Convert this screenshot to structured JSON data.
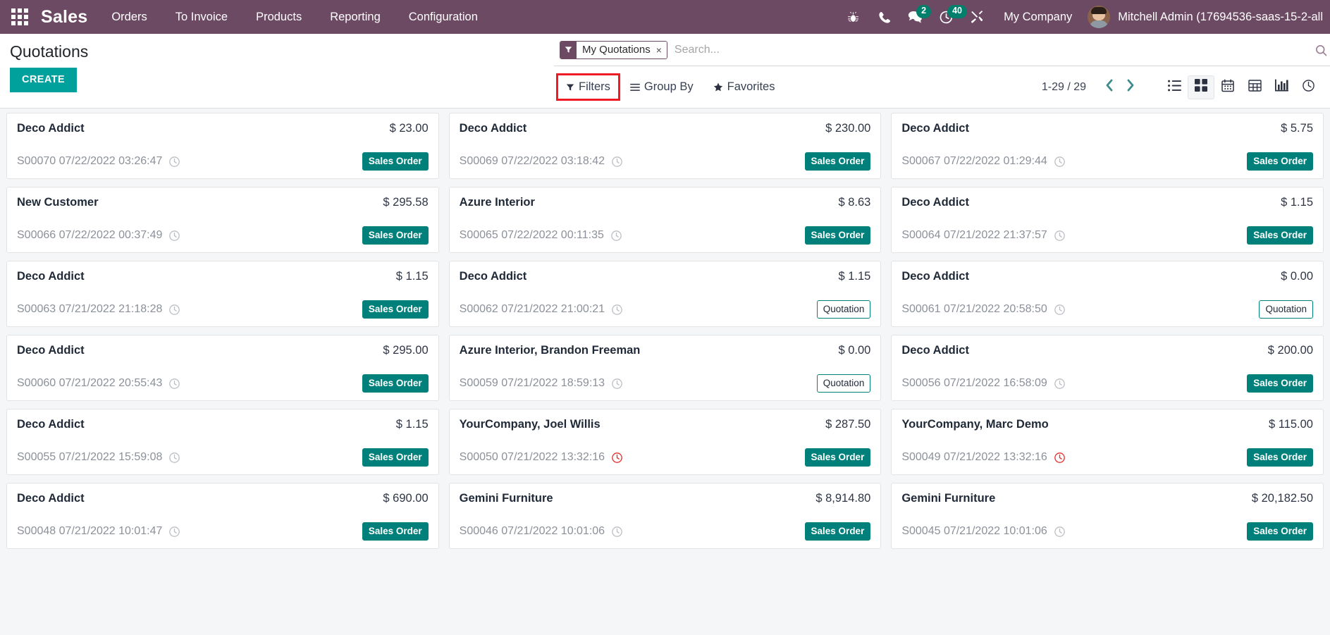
{
  "navbar": {
    "apps_icon": "apps-grid-icon",
    "brand": "Sales",
    "menus": [
      {
        "label": "Orders"
      },
      {
        "label": "To Invoice"
      },
      {
        "label": "Products"
      },
      {
        "label": "Reporting"
      },
      {
        "label": "Configuration"
      }
    ],
    "systray": [
      {
        "icon": "bug-icon",
        "badge": ""
      },
      {
        "icon": "phone-icon",
        "badge": ""
      },
      {
        "icon": "messages-icon",
        "badge": "2"
      },
      {
        "icon": "activities-clock-icon",
        "badge": "40"
      },
      {
        "icon": "tools-icon",
        "badge": ""
      }
    ],
    "company": "My Company",
    "user": "Mitchell Admin (17694536-saas-15-2-all"
  },
  "control_panel": {
    "title": "Quotations",
    "create_label": "CREATE",
    "search": {
      "facet_label": "My Quotations",
      "facet_icon": "filter-funnel-icon",
      "facet_close": "×",
      "placeholder": "Search...",
      "value": "",
      "magnifier_icon": "search-icon"
    },
    "filters_label": "Filters",
    "group_by_label": "Group By",
    "favorites_label": "Favorites",
    "pager": "1-29 / 29",
    "prev_icon": "chevron-left-icon",
    "next_icon": "chevron-right-icon",
    "views": [
      {
        "name": "list",
        "icon": "list-view-icon",
        "active": false
      },
      {
        "name": "kanban",
        "icon": "kanban-view-icon",
        "active": true
      },
      {
        "name": "calendar",
        "icon": "calendar-view-icon",
        "active": false
      },
      {
        "name": "pivot",
        "icon": "pivot-view-icon",
        "active": false
      },
      {
        "name": "graph",
        "icon": "graph-view-icon",
        "active": false
      },
      {
        "name": "activity",
        "icon": "activity-view-icon",
        "active": false
      }
    ],
    "highlight_color": "#ee1b24"
  },
  "colors": {
    "navbar_bg": "#6d4a63",
    "accent_teal": "#00a09d",
    "badge_teal": "#00806c",
    "state_sale_bg": "#00807b",
    "overdue_red": "#ea2e2e"
  },
  "kanban_cards": [
    {
      "partner": "Deco Addict",
      "amount": "$ 23.00",
      "ref": "S00070 07/22/2022 03:26:47",
      "clock": "grey",
      "state": "Sales Order",
      "state_kind": "sale"
    },
    {
      "partner": "Deco Addict",
      "amount": "$ 230.00",
      "ref": "S00069 07/22/2022 03:18:42",
      "clock": "grey",
      "state": "Sales Order",
      "state_kind": "sale"
    },
    {
      "partner": "Deco Addict",
      "amount": "$ 5.75",
      "ref": "S00067 07/22/2022 01:29:44",
      "clock": "grey",
      "state": "Sales Order",
      "state_kind": "sale"
    },
    {
      "partner": "New Customer",
      "amount": "$ 295.58",
      "ref": "S00066 07/22/2022 00:37:49",
      "clock": "grey",
      "state": "Sales Order",
      "state_kind": "sale"
    },
    {
      "partner": "Azure Interior",
      "amount": "$ 8.63",
      "ref": "S00065 07/22/2022 00:11:35",
      "clock": "grey",
      "state": "Sales Order",
      "state_kind": "sale"
    },
    {
      "partner": "Deco Addict",
      "amount": "$ 1.15",
      "ref": "S00064 07/21/2022 21:37:57",
      "clock": "grey",
      "state": "Sales Order",
      "state_kind": "sale"
    },
    {
      "partner": "Deco Addict",
      "amount": "$ 1.15",
      "ref": "S00063 07/21/2022 21:18:28",
      "clock": "grey",
      "state": "Sales Order",
      "state_kind": "sale"
    },
    {
      "partner": "Deco Addict",
      "amount": "$ 1.15",
      "ref": "S00062 07/21/2022 21:00:21",
      "clock": "grey",
      "state": "Quotation",
      "state_kind": "draft"
    },
    {
      "partner": "Deco Addict",
      "amount": "$ 0.00",
      "ref": "S00061 07/21/2022 20:58:50",
      "clock": "grey",
      "state": "Quotation",
      "state_kind": "draft"
    },
    {
      "partner": "Deco Addict",
      "amount": "$ 295.00",
      "ref": "S00060 07/21/2022 20:55:43",
      "clock": "grey",
      "state": "Sales Order",
      "state_kind": "sale"
    },
    {
      "partner": "Azure Interior, Brandon Freeman",
      "amount": "$ 0.00",
      "ref": "S00059 07/21/2022 18:59:13",
      "clock": "grey",
      "state": "Quotation",
      "state_kind": "draft"
    },
    {
      "partner": "Deco Addict",
      "amount": "$ 200.00",
      "ref": "S00056 07/21/2022 16:58:09",
      "clock": "grey",
      "state": "Sales Order",
      "state_kind": "sale"
    },
    {
      "partner": "Deco Addict",
      "amount": "$ 1.15",
      "ref": "S00055 07/21/2022 15:59:08",
      "clock": "grey",
      "state": "Sales Order",
      "state_kind": "sale"
    },
    {
      "partner": "YourCompany, Joel Willis",
      "amount": "$ 287.50",
      "ref": "S00050 07/21/2022 13:32:16",
      "clock": "red",
      "state": "Sales Order",
      "state_kind": "sale"
    },
    {
      "partner": "YourCompany, Marc Demo",
      "amount": "$ 115.00",
      "ref": "S00049 07/21/2022 13:32:16",
      "clock": "red",
      "state": "Sales Order",
      "state_kind": "sale"
    },
    {
      "partner": "Deco Addict",
      "amount": "$ 690.00",
      "ref": "S00048 07/21/2022 10:01:47",
      "clock": "grey",
      "state": "Sales Order",
      "state_kind": "sale"
    },
    {
      "partner": "Gemini Furniture",
      "amount": "$ 8,914.80",
      "ref": "S00046 07/21/2022 10:01:06",
      "clock": "grey",
      "state": "Sales Order",
      "state_kind": "sale"
    },
    {
      "partner": "Gemini Furniture",
      "amount": "$ 20,182.50",
      "ref": "S00045 07/21/2022 10:01:06",
      "clock": "grey",
      "state": "Sales Order",
      "state_kind": "sale"
    }
  ]
}
